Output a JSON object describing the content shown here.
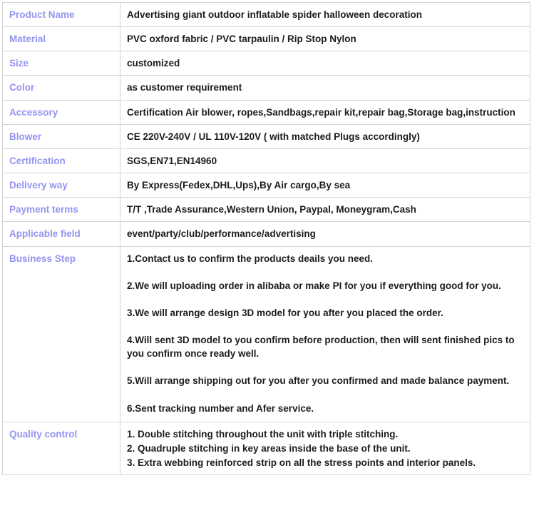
{
  "table": {
    "accent_label_color": "#9494f2",
    "value_color": "#1c1c1c",
    "border_color": "#d4d4d4",
    "rows": [
      {
        "label": "Product Name",
        "value": "Advertising giant outdoor inflatable spider halloween decoration"
      },
      {
        "label": "Material",
        "value": "PVC oxford fabric / PVC tarpaulin / Rip Stop Nylon"
      },
      {
        "label": "Size",
        "value": "customized"
      },
      {
        "label": "Color",
        "value": "as customer requirement"
      },
      {
        "label": "Accessory",
        "value": "Certification Air blower, ropes,Sandbags,repair kit,repair bag,Storage bag,instruction"
      },
      {
        "label": "Blower",
        "value": "CE 220V-240V / UL 110V-120V ( with matched Plugs accordingly)"
      },
      {
        "label": "Certification",
        "value": "SGS,EN71,EN14960"
      },
      {
        "label": "Delivery way",
        "value": "By Express(Fedex,DHL,Ups),By Air cargo,By sea"
      },
      {
        "label": "Payment terms",
        "value": "T/T ,Trade Assurance,Western Union, Paypal, Moneygram,Cash"
      },
      {
        "label": "Applicable field",
        "value": "event/party/club/performance/advertising"
      }
    ],
    "business_step": {
      "label": "Business Step",
      "steps": [
        "1.Contact us to confirm the products deails you need.",
        "2.We will uploading order in alibaba or make PI for you if everything good for you.",
        "3.We will arrange design 3D model for you after you placed the order.",
        "4.Will sent 3D model to you confirm before production, then will sent finished pics to you confirm once ready well.",
        "5.Will arrange shipping out for you after you confirmed and made balance payment.",
        "6.Sent tracking number and Afer service."
      ]
    },
    "quality_control": {
      "label": "Quality control",
      "points": [
        "1. Double stitching throughout the unit with triple stitching.",
        "2. Quadruple stitching in key areas inside the base of the unit.",
        "3. Extra webbing reinforced strip on all the stress points and interior panels."
      ]
    }
  }
}
